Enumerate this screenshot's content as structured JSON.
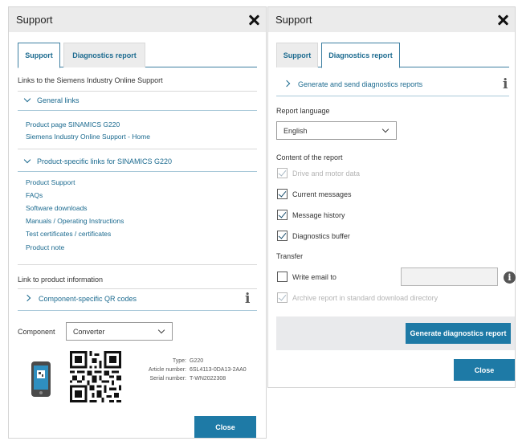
{
  "left": {
    "title": "Support",
    "tabs": [
      "Support",
      "Diagnostics report"
    ],
    "intro": "Links to the Siemens Industry Online Support",
    "general_links": {
      "header": "General links",
      "items": [
        "Product page SINAMICS G220",
        "Siemens Industry Online Support - Home"
      ]
    },
    "product_links": {
      "header": "Product-specific links for SINAMICS G220",
      "items": [
        "Product Support",
        "FAQs",
        "Software downloads",
        "Manuals / Operating Instructions",
        "Test certificates / certificates",
        "Product note"
      ]
    },
    "product_info_label": "Link to product information",
    "qr_section": "Component-specific QR codes",
    "component_label": "Component",
    "component_value": "Converter",
    "type_label": "Type:",
    "type_value": "G220",
    "article_label": "Article number:",
    "article_value": "6SL4113-0DA13-2AA0",
    "serial_label": "Serial number:",
    "serial_value": "T-WN2022308",
    "close_label": "Close"
  },
  "right": {
    "title": "Support",
    "tabs": [
      "Support",
      "Diagnostics report"
    ],
    "generate_section": "Generate and send diagnostics reports",
    "report_language_label": "Report language",
    "language_value": "English",
    "content_label": "Content of the report",
    "checkboxes": [
      {
        "label": "Drive and motor data",
        "checked": true,
        "disabled": true
      },
      {
        "label": "Current messages",
        "checked": true,
        "disabled": false
      },
      {
        "label": "Message history",
        "checked": true,
        "disabled": false
      },
      {
        "label": "Diagnostics buffer",
        "checked": true,
        "disabled": false
      }
    ],
    "transfer_label": "Transfer",
    "write_email_label": "Write email to",
    "archive_label": "Archive report in standard download directory",
    "generate_button": "Generate diagnostics report",
    "close_label": "Close"
  },
  "colors": {
    "accent": "#1e7aa6",
    "link": "#1b6a8f"
  }
}
